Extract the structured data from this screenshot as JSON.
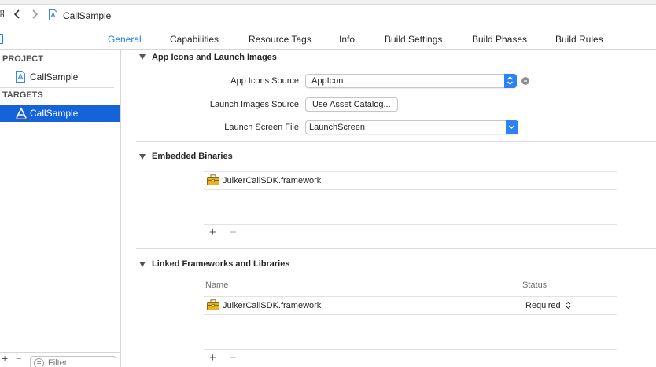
{
  "jump_bar": {
    "breadcrumb": "CallSample"
  },
  "tabs": [
    {
      "label": "General",
      "active": true
    },
    {
      "label": "Capabilities",
      "active": false
    },
    {
      "label": "Resource Tags",
      "active": false
    },
    {
      "label": "Info",
      "active": false
    },
    {
      "label": "Build Settings",
      "active": false
    },
    {
      "label": "Build Phases",
      "active": false
    },
    {
      "label": "Build Rules",
      "active": false
    }
  ],
  "sidebar": {
    "project_header": "PROJECT",
    "project_item": "CallSample",
    "targets_header": "TARGETS",
    "target_item": "CallSample",
    "filter_placeholder": "Filter"
  },
  "app_icons_section": {
    "title": "App Icons and Launch Images",
    "app_icons_source_label": "App Icons Source",
    "app_icons_source_value": "AppIcon",
    "launch_images_source_label": "Launch Images Source",
    "launch_images_button": "Use Asset Catalog...",
    "launch_screen_file_label": "Launch Screen File",
    "launch_screen_file_value": "LaunchScreen"
  },
  "embedded_binaries_section": {
    "title": "Embedded Binaries",
    "rows": [
      {
        "name": "JuikerCallSDK.framework"
      }
    ],
    "add": "+",
    "remove": "−"
  },
  "linked_frameworks_section": {
    "title": "Linked Frameworks and Libraries",
    "column_name": "Name",
    "column_status": "Status",
    "rows": [
      {
        "name": "JuikerCallSDK.framework",
        "status": "Required"
      }
    ],
    "add": "+",
    "remove": "−"
  },
  "colors": {
    "accent": "#1a7cf5",
    "selection": "#1463d9",
    "framework_icon": "#e6b422"
  },
  "icons": [
    "grid-icon",
    "back-icon",
    "forward-icon",
    "project-file-icon",
    "app-target-icon",
    "disclosure-triangle-icon",
    "popup-stepper-icon",
    "goto-arrow-icon",
    "framework-toolbox-icon",
    "filter-icon"
  ]
}
